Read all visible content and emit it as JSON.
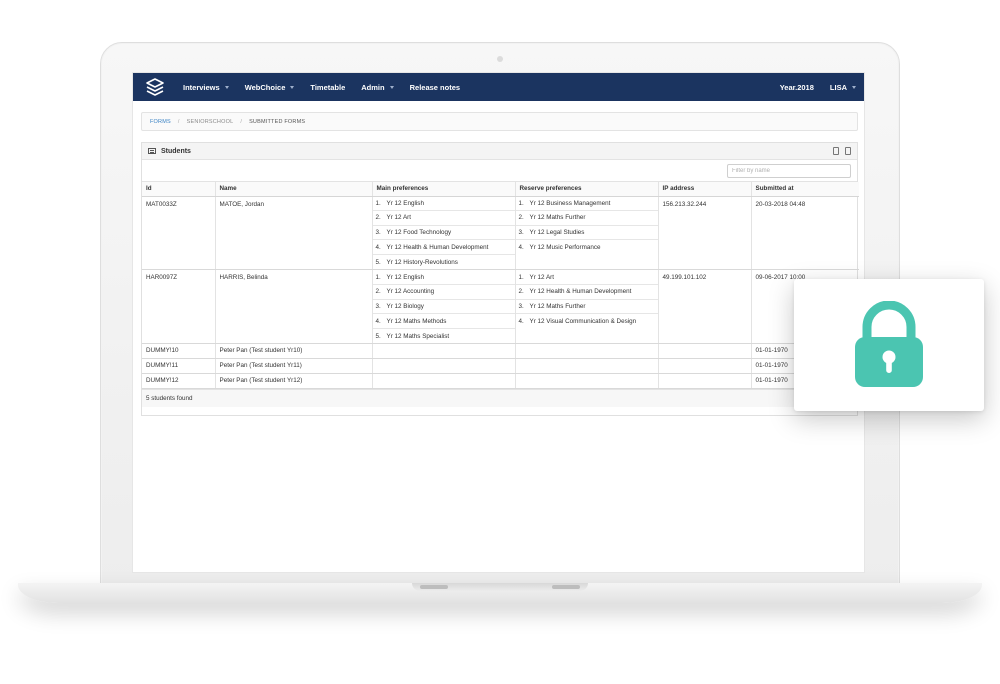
{
  "nav": {
    "items": [
      {
        "label": "Interviews",
        "dropdown": true
      },
      {
        "label": "WebChoice",
        "dropdown": true
      },
      {
        "label": "Timetable",
        "dropdown": false
      },
      {
        "label": "Admin",
        "dropdown": true
      },
      {
        "label": "Release notes",
        "dropdown": false
      }
    ],
    "year": "Year.2018",
    "user": "LISA"
  },
  "breadcrumb": {
    "forms": "FORMS",
    "seniorschool": "SENIORSCHOOL",
    "current": "SUBMITTED FORMS"
  },
  "panel": {
    "title": "Students",
    "filter_placeholder": "Filter by name",
    "footer": "5 students found"
  },
  "table": {
    "headers": [
      "Id",
      "Name",
      "Main preferences",
      "Reserve preferences",
      "IP address",
      "Submitted at"
    ],
    "rows": [
      {
        "id": "MAT0033Z",
        "name": "MATOE, Jordan",
        "main": [
          "Yr 12 English",
          "Yr 12 Art",
          "Yr 12 Food Technology",
          "Yr 12 Health & Human Development",
          "Yr 12 History-Revolutions"
        ],
        "reserve": [
          "Yr 12 Business Management",
          "Yr 12 Maths Further",
          "Yr 12 Legal Studies",
          "Yr 12 Music Performance"
        ],
        "ip": "156.213.32.244",
        "submitted": "20-03-2018 04:48"
      },
      {
        "id": "HAR0097Z",
        "name": "HARRIS, Belinda",
        "main": [
          "Yr 12 English",
          "Yr 12 Accounting",
          "Yr 12 Biology",
          "Yr 12 Maths Methods",
          "Yr 12 Maths Specialist"
        ],
        "reserve": [
          "Yr 12 Art",
          "Yr 12 Health & Human Development",
          "Yr 12 Maths Further",
          "Yr 12 Visual Communication & Design"
        ],
        "ip": "49.199.101.102",
        "submitted": "09-06-2017 10:00"
      },
      {
        "id": "DUMMY!10",
        "name": "Peter Pan (Test student Yr10)",
        "main": [],
        "reserve": [],
        "ip": "",
        "submitted": "01-01-1970"
      },
      {
        "id": "DUMMY!11",
        "name": "Peter Pan (Test student Yr11)",
        "main": [],
        "reserve": [],
        "ip": "",
        "submitted": "01-01-1970"
      },
      {
        "id": "DUMMY!12",
        "name": "Peter Pan (Test student Yr12)",
        "main": [],
        "reserve": [],
        "ip": "",
        "submitted": "01-01-1970"
      }
    ]
  },
  "colors": {
    "navbar": "#1b3460",
    "link": "#3a82c4",
    "lock": "#4bc5b1"
  },
  "icons": {
    "logo": "stacked-layers-icon",
    "lock": "padlock-icon"
  }
}
